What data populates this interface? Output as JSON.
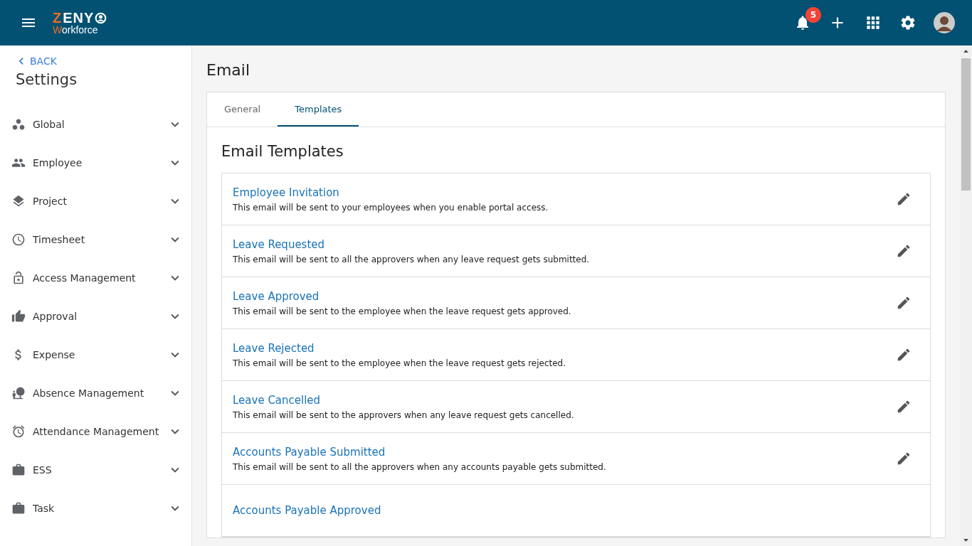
{
  "header": {
    "logo": {
      "top_accent": "Z",
      "top_rest": "ENY",
      "bottom_accent": "W",
      "bottom_rest": "orkforce"
    },
    "notification_count": "5"
  },
  "sidebar": {
    "back": "BACK",
    "title": "Settings",
    "items": [
      {
        "label": "Global",
        "expanded": false
      },
      {
        "label": "Employee",
        "expanded": false
      },
      {
        "label": "Project",
        "expanded": false
      },
      {
        "label": "Timesheet",
        "expanded": false
      },
      {
        "label": "Access Management",
        "expanded": false
      },
      {
        "label": "Approval",
        "expanded": false
      },
      {
        "label": "Expense",
        "expanded": false
      },
      {
        "label": "Absence Management",
        "expanded": false
      },
      {
        "label": "Attendance Management",
        "expanded": false
      },
      {
        "label": "ESS",
        "expanded": false
      },
      {
        "label": "Task",
        "expanded": false
      }
    ]
  },
  "page_title": "Email",
  "tabs": [
    {
      "label": "General",
      "selected": false
    },
    {
      "label": "Templates",
      "selected": true
    }
  ],
  "section_title": "Email Templates",
  "templates": [
    {
      "title": "Employee Invitation",
      "description": "This email will be sent to your employees when you enable portal access."
    },
    {
      "title": "Leave Requested",
      "description": "This email will be sent to all the approvers when any leave request gets submitted."
    },
    {
      "title": "Leave Approved",
      "description": "This email will be sent to the employee when the leave request gets approved."
    },
    {
      "title": "Leave Rejected",
      "description": "This email will be sent to the employee when the leave request gets rejected."
    },
    {
      "title": "Leave Cancelled",
      "description": "This email will be sent to the approvers when any leave request gets cancelled."
    },
    {
      "title": "Accounts Payable Submitted",
      "description": "This email will be sent to all the approvers when any accounts payable gets submitted."
    },
    {
      "title": "Accounts Payable Approved"
    }
  ]
}
